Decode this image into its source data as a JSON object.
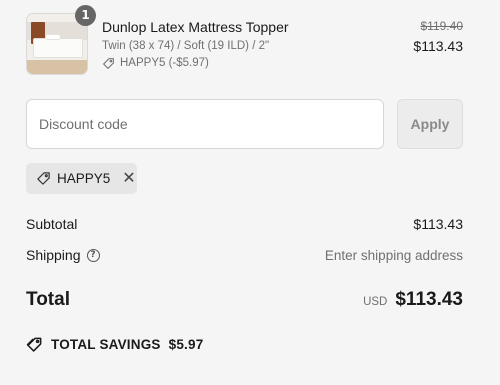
{
  "line_item": {
    "quantity": "1",
    "title": "Dunlop Latex Mattress Topper",
    "variant": "Twin (38 x 74) / Soft (19 ILD) / 2\"",
    "discount": "HAPPY5 (-$5.97)",
    "original_price": "$119.40",
    "price": "$113.43"
  },
  "discount": {
    "placeholder": "Discount code",
    "apply_label": "Apply",
    "applied_code": "HAPPY5"
  },
  "summary": {
    "subtotal_label": "Subtotal",
    "subtotal_value": "$113.43",
    "shipping_label": "Shipping",
    "shipping_value": "Enter shipping address",
    "total_label": "Total",
    "currency": "USD",
    "total_value": "$113.43",
    "savings_label": "TOTAL SAVINGS",
    "savings_value": "$5.97"
  },
  "icons": {
    "help": "?",
    "remove": "✕"
  }
}
